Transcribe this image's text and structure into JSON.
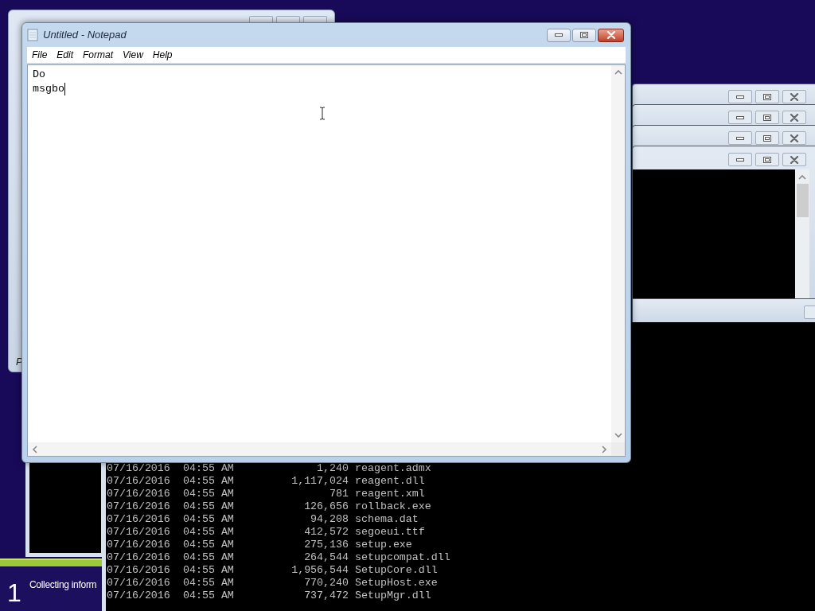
{
  "back_window": {
    "status_text": "P"
  },
  "notepad": {
    "title": "Untitled - Notepad",
    "active": true,
    "menu": [
      "File",
      "Edit",
      "Format",
      "View",
      "Help"
    ],
    "lines": [
      "Do",
      "msgbo"
    ]
  },
  "console": {
    "rows": [
      {
        "date": "07/16/2016",
        "time": "04:55 AM",
        "size": "1,240",
        "name": "reagent.admx"
      },
      {
        "date": "07/16/2016",
        "time": "04:55 AM",
        "size": "1,117,024",
        "name": "reagent.dll"
      },
      {
        "date": "07/16/2016",
        "time": "04:55 AM",
        "size": "781",
        "name": "reagent.xml"
      },
      {
        "date": "07/16/2016",
        "time": "04:55 AM",
        "size": "126,656",
        "name": "rollback.exe"
      },
      {
        "date": "07/16/2016",
        "time": "04:55 AM",
        "size": "94,208",
        "name": "schema.dat"
      },
      {
        "date": "07/16/2016",
        "time": "04:55 AM",
        "size": "412,572",
        "name": "segoeui.ttf"
      },
      {
        "date": "07/16/2016",
        "time": "04:55 AM",
        "size": "275,136",
        "name": "setup.exe"
      },
      {
        "date": "07/16/2016",
        "time": "04:55 AM",
        "size": "264,544",
        "name": "setupcompat.dll"
      },
      {
        "date": "07/16/2016",
        "time": "04:55 AM",
        "size": "1,956,544",
        "name": "SetupCore.dll"
      },
      {
        "date": "07/16/2016",
        "time": "04:55 AM",
        "size": "770,240",
        "name": "SetupHost.exe"
      },
      {
        "date": "07/16/2016",
        "time": "04:55 AM",
        "size": "737,472",
        "name": "SetupMgr.dll"
      }
    ]
  },
  "setup": {
    "step": "1",
    "status": "Collecting inform",
    "level": 1
  }
}
